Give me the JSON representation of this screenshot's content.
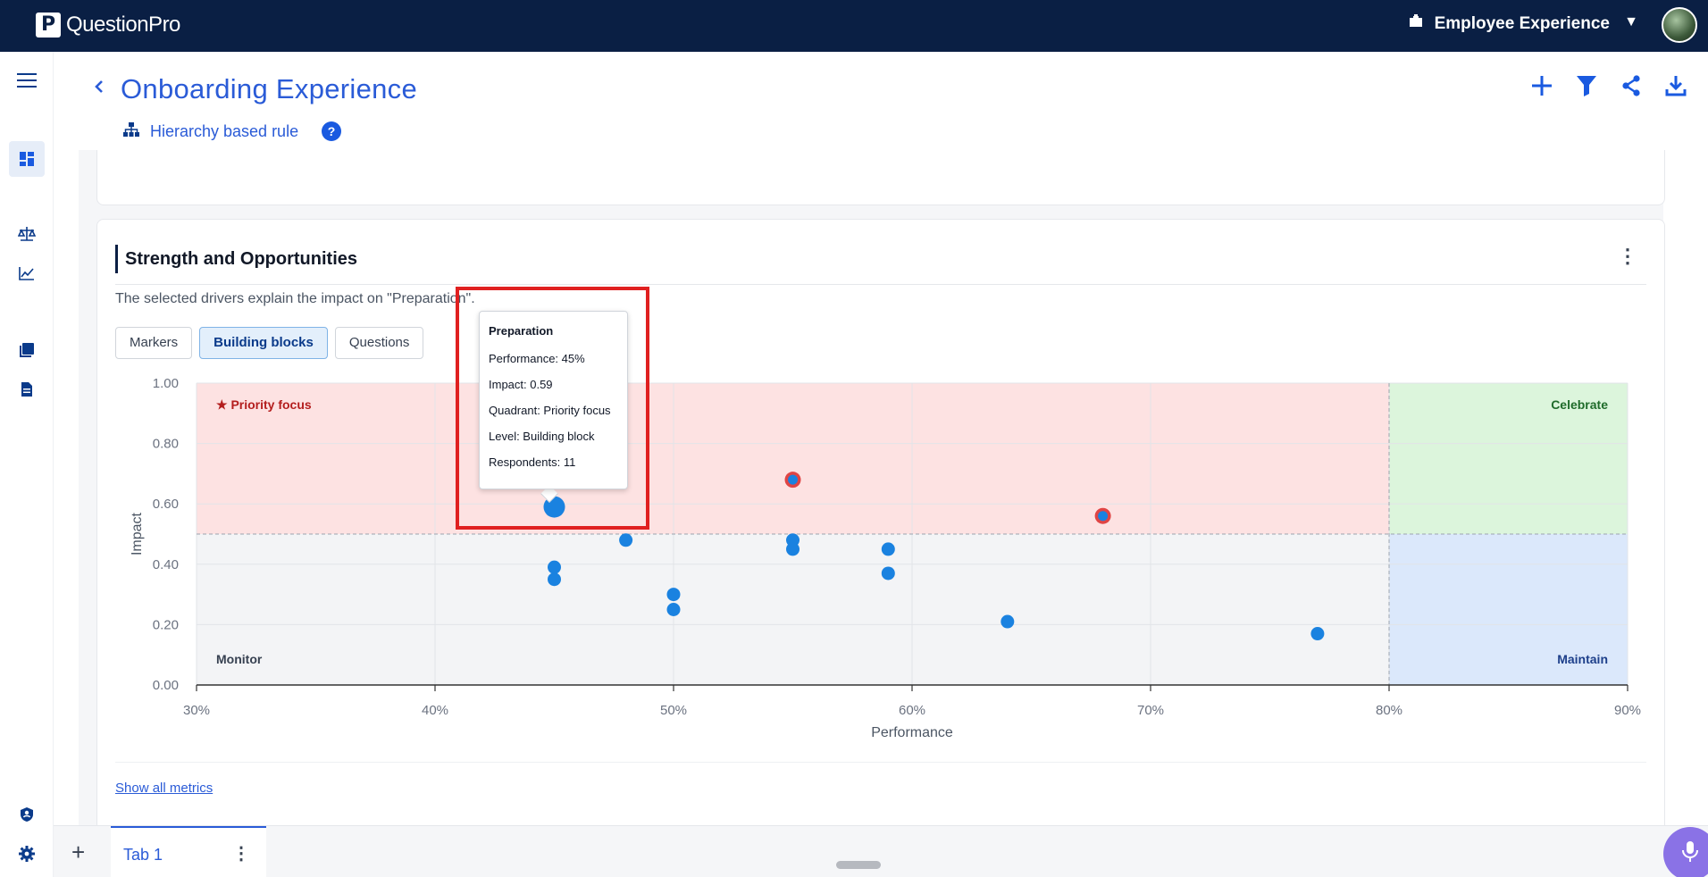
{
  "app": {
    "brand_letter": "P",
    "brand_name": "QuestionPro",
    "product": "Employee Experience"
  },
  "header": {
    "title": "Onboarding Experience",
    "rule_label": "Hierarchy based rule",
    "help": "?"
  },
  "card": {
    "title": "Strength and Opportunities",
    "description": "The selected drivers explain the impact on \"Preparation\".",
    "tabs": [
      {
        "label": "Markers",
        "active": false
      },
      {
        "label": "Building blocks",
        "active": true
      },
      {
        "label": "Questions",
        "active": false
      }
    ],
    "show_all": "Show all metrics"
  },
  "chart_data": {
    "type": "scatter",
    "xlabel": "Performance",
    "ylabel": "Impact",
    "xlim": [
      30,
      90
    ],
    "ylim": [
      0,
      1
    ],
    "x_ticks": [
      "30%",
      "40%",
      "50%",
      "60%",
      "70%",
      "80%",
      "90%"
    ],
    "y_ticks": [
      "0.00",
      "0.20",
      "0.40",
      "0.60",
      "0.80",
      "1.00"
    ],
    "x_threshold": 80,
    "y_threshold": 0.5,
    "quadrants": {
      "priority_focus": "★ Priority focus",
      "celebrate": "Celebrate",
      "monitor": "Monitor",
      "maintain": "Maintain"
    },
    "quadrant_colors": {
      "priority": "#fde2e2",
      "celebrate": "#dcf5dc",
      "monitor": "#f3f4f6",
      "maintain": "#dbe8fb"
    },
    "point_color": "#1a82e0",
    "flag_color": "#e04545",
    "points": [
      {
        "x": 45,
        "y": 0.59,
        "hovered": true
      },
      {
        "x": 45,
        "y": 0.39
      },
      {
        "x": 45,
        "y": 0.35
      },
      {
        "x": 48,
        "y": 0.48
      },
      {
        "x": 50,
        "y": 0.3
      },
      {
        "x": 50,
        "y": 0.25
      },
      {
        "x": 55,
        "y": 0.68,
        "flagged": true
      },
      {
        "x": 55,
        "y": 0.48
      },
      {
        "x": 55,
        "y": 0.45
      },
      {
        "x": 59,
        "y": 0.45
      },
      {
        "x": 59,
        "y": 0.37
      },
      {
        "x": 64,
        "y": 0.21
      },
      {
        "x": 68,
        "y": 0.56,
        "flagged": true
      },
      {
        "x": 77,
        "y": 0.17
      }
    ]
  },
  "tooltip": {
    "title": "Preparation",
    "performance": "Performance: 45%",
    "impact": "Impact: 0.59",
    "quadrant": "Quadrant: Priority focus",
    "level": "Level: Building block",
    "respondents": "Respondents: 11"
  },
  "tabbar": {
    "add": "+",
    "tab_label": "Tab 1"
  }
}
